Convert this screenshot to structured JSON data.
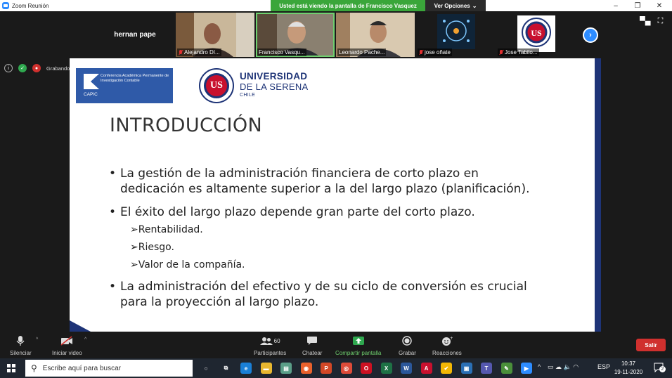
{
  "window": {
    "title": "Zoom Reunión",
    "minimize": "–",
    "restore": "❐",
    "close": "✕"
  },
  "share_banner": {
    "text": "Usted está viendo la pantalla de Francisco Vasquez",
    "options_label": "Ver Opciones",
    "options_caret": "⌄"
  },
  "participants_strip": {
    "name_card": "hernan pape",
    "tiles": [
      {
        "name": "Alejandro Dí...",
        "muted": true,
        "active": false
      },
      {
        "name": "Francisco Vasqu...",
        "muted": false,
        "active": true
      },
      {
        "name": "Leonardo Pache...",
        "muted": false,
        "active": false
      },
      {
        "name": "jose oñate",
        "muted": true,
        "active": false
      },
      {
        "name": "Jose Tabilo...",
        "muted": true,
        "active": false
      }
    ],
    "next_label": "›"
  },
  "status": {
    "recording_label": "Grabando",
    "info_glyph": "i",
    "shield_glyph": "✓",
    "rec_glyph": "●"
  },
  "slide": {
    "capic": {
      "text": "Conferencia Académica Permanente de Investigación Contable",
      "abbr": "CAPIC"
    },
    "university": {
      "seal_letters": "US",
      "line1": "UNIVERSIDAD",
      "line2": "DE LA SERENA",
      "line3": "CHILE"
    },
    "title": "INTRODUCCIÓN",
    "bullet_glyph": "•",
    "sub_glyph": "➢",
    "bullets": [
      {
        "line1": "La gestión de la administración financiera de corto plazo en",
        "line2": "dedicación es altamente superior a la del largo plazo (planificación)."
      },
      {
        "line1": "El éxito del largo plazo depende gran parte del corto plazo.",
        "line2": ""
      },
      {
        "line1": "La administración del efectivo y de su ciclo de conversión es crucial",
        "line2": "para la proyección al largo plazo."
      }
    ],
    "subitems": [
      "Rentabilidad.",
      "Riesgo.",
      "Valor de la compañía."
    ]
  },
  "toolbar": {
    "mute": "Silenciar",
    "video": "Iniciar video",
    "participants": "Participantes",
    "participants_count": "60",
    "chat": "Chatear",
    "share": "Compartir pantalla",
    "record": "Grabar",
    "reactions": "Reacciones",
    "leave": "Salir",
    "caret": "^"
  },
  "taskbar": {
    "search_placeholder": "Escribe aquí para buscar",
    "search_glyph": "⚲",
    "language": "ESP",
    "time": "10:37",
    "date": "19-11-2020",
    "notification_count": "2",
    "tray_caret": "^",
    "tray_glyphs": "▭ ☁ 🔈 ◠",
    "apps": [
      {
        "name": "cortana-icon",
        "glyph": "○",
        "color": "#1f2630"
      },
      {
        "name": "task-view-icon",
        "glyph": "⧉",
        "color": "#1f2630"
      },
      {
        "name": "edge-icon",
        "glyph": "e",
        "color": "#1a7fd6"
      },
      {
        "name": "file-explorer-icon",
        "glyph": "▬",
        "color": "#e8b730"
      },
      {
        "name": "sticky-notes-icon",
        "glyph": "▤",
        "color": "#5a9e88"
      },
      {
        "name": "firefox-icon",
        "glyph": "◉",
        "color": "#e8612c"
      },
      {
        "name": "powerpoint-icon",
        "glyph": "P",
        "color": "#d24726"
      },
      {
        "name": "chrome-icon",
        "glyph": "◎",
        "color": "#dd4b39"
      },
      {
        "name": "opera-icon",
        "glyph": "O",
        "color": "#cc1122"
      },
      {
        "name": "excel-icon",
        "glyph": "X",
        "color": "#1e7145"
      },
      {
        "name": "word-icon",
        "glyph": "W",
        "color": "#2b579a"
      },
      {
        "name": "acrobat-icon",
        "glyph": "A",
        "color": "#c8102e"
      },
      {
        "name": "norton-icon",
        "glyph": "✔",
        "color": "#f2b705"
      },
      {
        "name": "photos-icon",
        "glyph": "▣",
        "color": "#2a6fb5"
      },
      {
        "name": "teams-icon",
        "glyph": "T",
        "color": "#5558af"
      },
      {
        "name": "paint-icon",
        "glyph": "✎",
        "color": "#4a8f3a"
      },
      {
        "name": "zoom-icon",
        "glyph": "▶",
        "color": "#2d8cff"
      }
    ]
  }
}
